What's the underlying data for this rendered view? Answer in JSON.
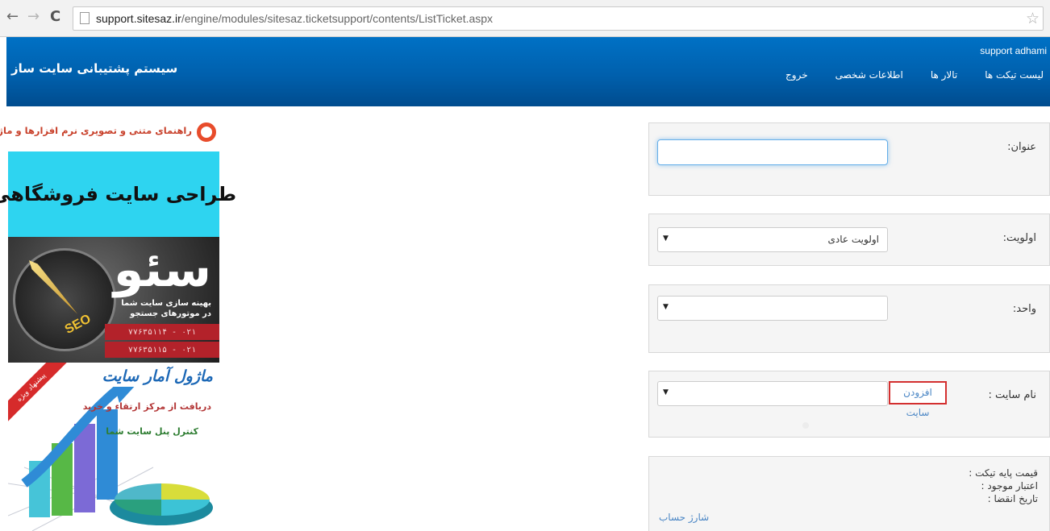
{
  "browser": {
    "url_host": "support.sitesaz.ir",
    "url_path": "/engine/modules/sitesaz.ticketsupport/contents/ListTicket.aspx",
    "back_icon": "←",
    "forward_icon": "→",
    "reload_icon": "C",
    "star_icon": "☆"
  },
  "header": {
    "site_title": "سیستم پشتیبانی سایت ساز",
    "user": "support adhami",
    "nav": [
      {
        "label": "لیست تیکت ها"
      },
      {
        "label": "تالار ها"
      },
      {
        "label": "اطلاعات شخصی"
      },
      {
        "label": "خروج"
      }
    ],
    "gradient_top": "#0071c5",
    "gradient_bottom": "#004c8e"
  },
  "ads": {
    "caption": "راهنمای متنی و تصویری نرم افزارها و ماژول ها",
    "shop_banner": "طراحی سایت فروشگاهی",
    "seo_banner": {
      "big_text": "سئو",
      "seo_label": "SEO",
      "desc_line1": "بهینه سازی سایت شما",
      "desc_line2": "در موتورهای جستجو",
      "phone1": "۰۲۱ - ۷۷۶۳۵۱۱۴",
      "phone2": "۰۲۱ - ۷۷۶۳۵۱۱۵"
    },
    "stats_banner": {
      "ribbon": "پیشنهاد ویژه",
      "title": "ماژول آمار سایت",
      "line1": "دریافت از مرکز ارتقاء و خرید",
      "line2": "کنترل پنل سایت شما"
    }
  },
  "form": {
    "subject": {
      "label": "عنوان:",
      "value": ""
    },
    "priority": {
      "label": "اولویت:",
      "selected": "اولویت عادی"
    },
    "unit": {
      "label": "واحد:",
      "selected": ""
    },
    "site_name": {
      "label": "نام سایت :",
      "selected": "",
      "add_link": "افزودن سایت"
    },
    "info": {
      "base_price": "قیمت پایه تیکت :",
      "balance": "اعتبار موجود :",
      "expiry": "تاریخ انقضا :",
      "charge_link": "شارژ حساب"
    },
    "select_arrow": "▼"
  }
}
